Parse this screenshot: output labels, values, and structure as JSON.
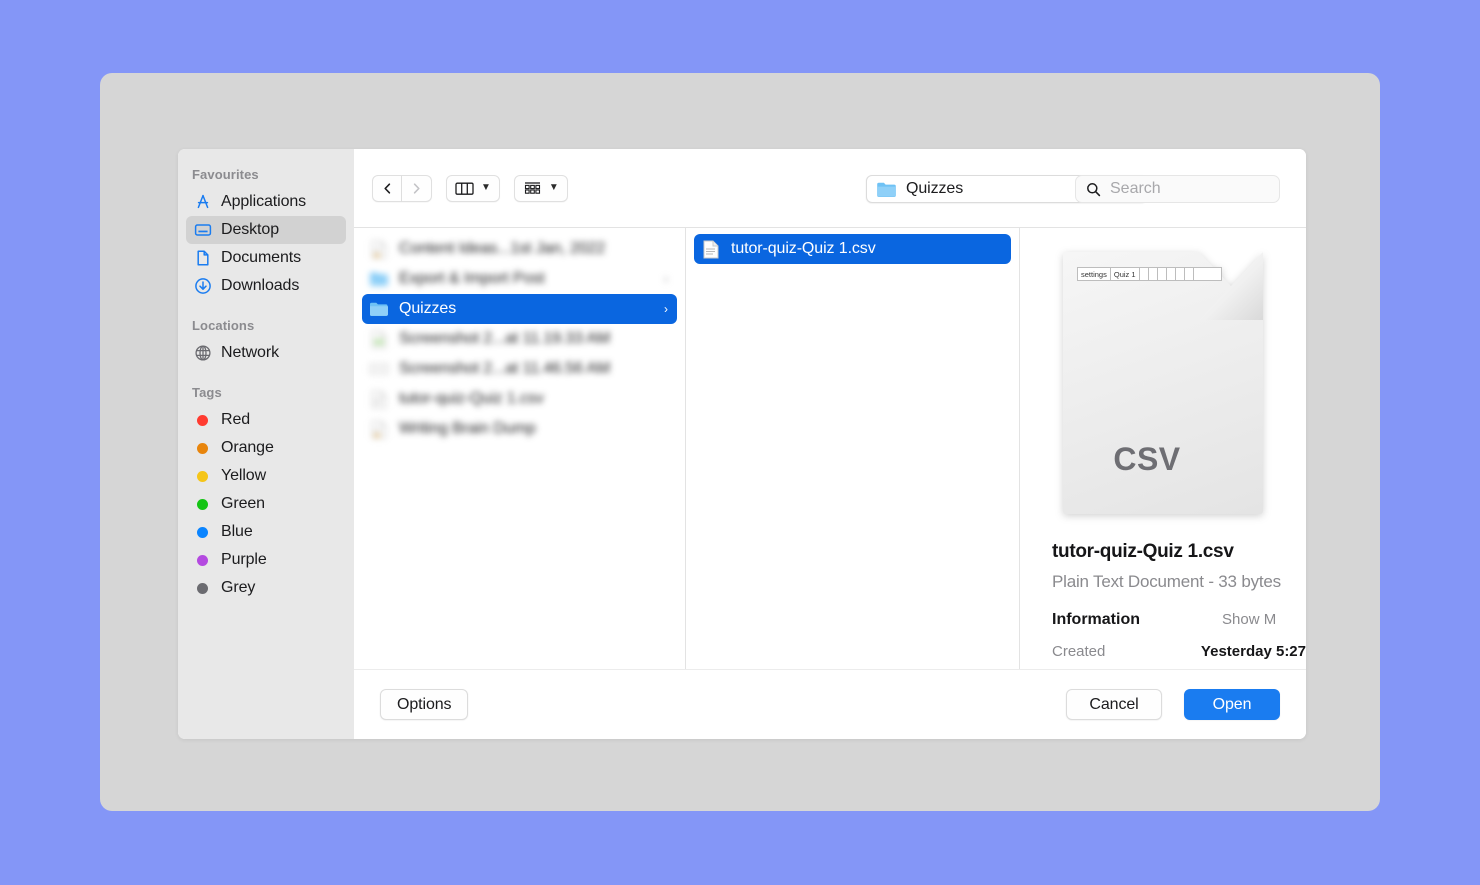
{
  "sidebar": {
    "sections": [
      {
        "header": "Favourites",
        "items": [
          {
            "label": "Applications",
            "icon": "applications-icon",
            "selected": false
          },
          {
            "label": "Desktop",
            "icon": "desktop-icon",
            "selected": true
          },
          {
            "label": "Documents",
            "icon": "documents-icon",
            "selected": false
          },
          {
            "label": "Downloads",
            "icon": "downloads-icon",
            "selected": false
          }
        ]
      },
      {
        "header": "Locations",
        "items": [
          {
            "label": "Network",
            "icon": "network-globe-icon",
            "selected": false
          }
        ]
      },
      {
        "header": "Tags",
        "items": [
          {
            "label": "Red",
            "icon": "tag-dot-icon",
            "color": "#ff3b30"
          },
          {
            "label": "Orange",
            "icon": "tag-dot-icon",
            "color": "#e8850c"
          },
          {
            "label": "Yellow",
            "icon": "tag-dot-icon",
            "color": "#f5c518"
          },
          {
            "label": "Green",
            "icon": "tag-dot-icon",
            "color": "#14c414"
          },
          {
            "label": "Blue",
            "icon": "tag-dot-icon",
            "color": "#0a84ff"
          },
          {
            "label": "Purple",
            "icon": "tag-dot-icon",
            "color": "#b44ae0"
          },
          {
            "label": "Grey",
            "icon": "tag-dot-icon",
            "color": "#6b6b70"
          }
        ]
      }
    ]
  },
  "toolbar": {
    "back_label": "Back",
    "forward_label": "Forward",
    "view_mode": "column-view",
    "arrange_label": "group-items",
    "path": {
      "label": "Quizzes",
      "icon": "folder-icon"
    },
    "search": {
      "value": "",
      "placeholder": "Search",
      "icon": "search-icon"
    }
  },
  "columns": {
    "first": [
      {
        "label": "Content Ideas...1st Jan, 2022",
        "icon": "document-icon",
        "blurred": true,
        "selected": false,
        "disclosure": false
      },
      {
        "label": "Export & Import Post",
        "icon": "folder-icon",
        "blurred": true,
        "selected": false,
        "disclosure": true
      },
      {
        "label": "Quizzes",
        "icon": "folder-icon",
        "blurred": false,
        "selected": true,
        "disclosure": true
      },
      {
        "label": "Screenshot 2...at 11.19.33 AM",
        "icon": "image-icon",
        "blurred": true,
        "selected": false,
        "disclosure": false
      },
      {
        "label": "Screenshot 2...at 11.46.56 AM",
        "icon": "image-icon",
        "blurred": true,
        "selected": false,
        "disclosure": false
      },
      {
        "label": "tutor-quiz-Quiz 1.csv",
        "icon": "csv-icon",
        "blurred": true,
        "selected": false,
        "disclosure": false
      },
      {
        "label": "Writing Brain Dump",
        "icon": "document-icon",
        "blurred": true,
        "selected": false,
        "disclosure": false
      }
    ],
    "second": [
      {
        "label": "tutor-quiz-Quiz 1.csv",
        "icon": "csv-icon",
        "blurred": false,
        "selected": true,
        "disclosure": false
      }
    ]
  },
  "preview": {
    "icon_type": "CSV",
    "thumbnail_cells": [
      "settings",
      "Quiz 1"
    ],
    "filename": "tutor-quiz-Quiz 1.csv",
    "kind_and_size": "Plain Text Document - 33 bytes",
    "information_label": "Information",
    "show_more_label": "Show M",
    "created_key": "Created",
    "created_value": "Yesterday 5:27"
  },
  "footer": {
    "options_label": "Options",
    "cancel_label": "Cancel",
    "open_label": "Open"
  },
  "colors": {
    "desktop_background": "#8496f7",
    "window_backdrop": "#d6d6d6",
    "sidebar": "#e8e8e8",
    "selection_blue": "#0a66e0",
    "accent_blue": "#1a7cf0"
  }
}
